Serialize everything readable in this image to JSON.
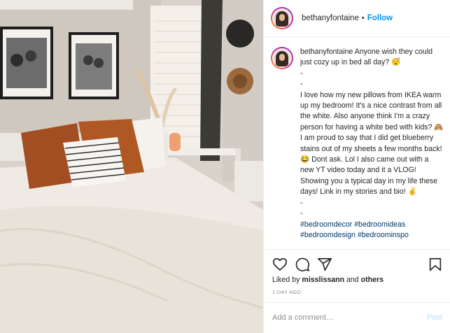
{
  "photo": {
    "alt_subject": "bedroom"
  },
  "header": {
    "username": "bethanyfontaine",
    "separator": "•",
    "follow_label": "Follow"
  },
  "caption": {
    "username": "bethanyfontaine",
    "text_1": "Anyone wish they could just cozy up in bed all day? 😴\n-\n-\nI love how my new pillows from IKEA warm up my bedroom! It's a nice contrast from all the white. Also anyone think I'm a crazy person for having a white bed with kids? 🙈 I am proud to say that I did get blueberry stains out of my sheets a few months back! 😂 Dont ask. Lol I also came out with a new YT video today and it a VLOG! Showing you a typical day in my life these days! Link in my stories and bio! ✌\n-\n-\n",
    "hashtags": [
      "#bedroomdecor",
      "#bedroomideas",
      "#bedroomdesign",
      "#bedroominspo"
    ]
  },
  "actions": {
    "like_icon": "heart-icon",
    "comment_icon": "comment-icon",
    "share_icon": "paper-plane-icon",
    "save_icon": "bookmark-icon"
  },
  "likes": {
    "prefix": "Liked by ",
    "user": "misslissann",
    "middle": " and ",
    "others": "others"
  },
  "timestamp": "1 DAY AGO",
  "composer": {
    "placeholder": "Add a comment…",
    "post_label": "Post"
  },
  "colors": {
    "link": "#0095f6",
    "hashtag": "#00376b",
    "muted": "#8e8e8e",
    "post_disabled": "#b2dffc"
  }
}
